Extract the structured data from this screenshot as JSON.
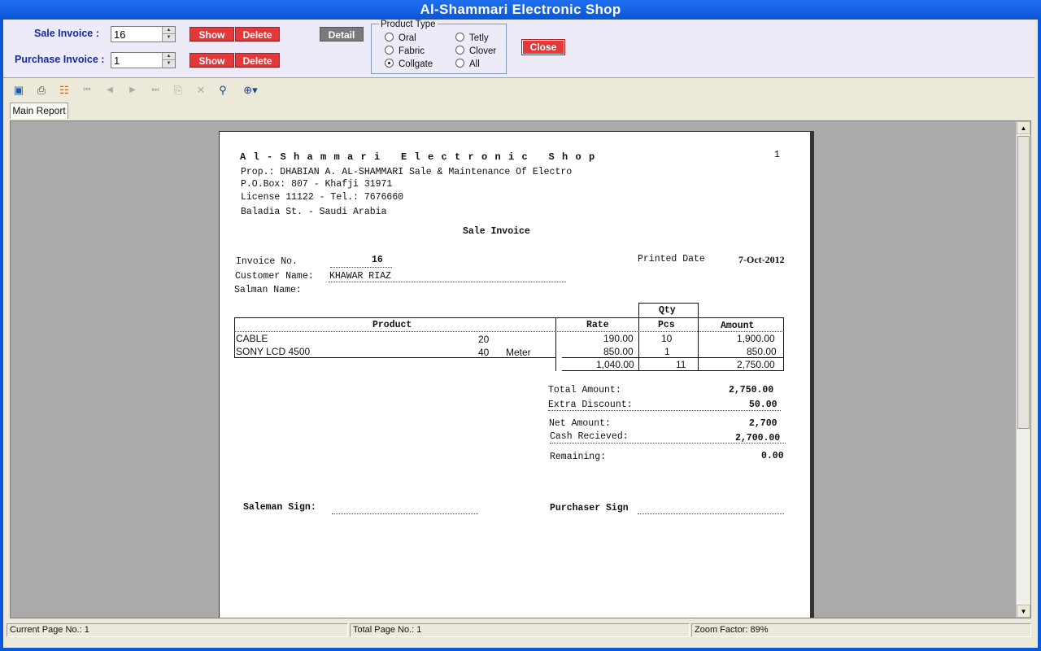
{
  "window": {
    "title": "Al-Shammari Electronic Shop"
  },
  "controls": {
    "sale_invoice_label": "Sale Invoice :",
    "sale_invoice_value": "16",
    "purchase_invoice_label": "Purchase Invoice :",
    "purchase_invoice_value": "1",
    "show_label": "Show",
    "delete_label": "Delete",
    "detail_label": "Detail",
    "close_label": "Close",
    "product_type": {
      "legend": "Product Type",
      "options": [
        "Oral",
        "Fabric",
        "Collgate",
        "Tetly",
        "Clover",
        "All"
      ],
      "selected": "Collgate"
    }
  },
  "toolbar": {
    "icons": [
      "export-icon",
      "print-icon",
      "toggle-tree-icon",
      "first-page-icon",
      "prev-page-icon",
      "next-page-icon",
      "last-page-icon",
      "goto-page-icon",
      "stop-icon",
      "search-icon",
      "zoom-icon"
    ]
  },
  "tabs": [
    "Main Report"
  ],
  "report": {
    "shop_name": "Al-Shammari Electronic Shop",
    "page_no": "1",
    "prop_line": "Prop.: DHABIAN A. AL-SHAMMARI Sale & Maintenance Of Electro",
    "pobox_line": "P.O.Box: 807 - Khafji 31971",
    "license_line": "License 11122 - Tel.: 7676660",
    "address_line": "Baladia St. - Saudi Arabia",
    "doc_title": "Sale Invoice",
    "invoice_no_label": "Invoice No.",
    "invoice_no": "16",
    "printed_date_label": "Printed Date",
    "printed_date": "7-Oct-2012",
    "customer_label": "Customer Name:",
    "customer_name": "KHAWAR RIAZ",
    "salesman_label": "Salman Name:",
    "headers": {
      "product": "Product",
      "rate": "Rate",
      "qty": "Qty",
      "pcs": "Pcs",
      "amount": "Amount"
    },
    "rows": [
      {
        "product": "CABLE",
        "code": "20",
        "unit": "",
        "rate": "190.00",
        "pcs": "10",
        "amount": "1,900.00"
      },
      {
        "product": "SONY LCD 4500",
        "code": "40",
        "unit": "Meter",
        "rate": "850.00",
        "pcs": "1",
        "amount": "850.00"
      }
    ],
    "totals_row": {
      "rate": "1,040.00",
      "pcs": "11",
      "amount": "2,750.00"
    },
    "summary": {
      "total_amount_label": "Total Amount:",
      "total_amount": "2,750.00",
      "extra_discount_label": "Extra Discount:",
      "extra_discount": "50.00",
      "net_amount_label": "Net Amount:",
      "net_amount": "2,700",
      "cash_received_label": "Cash Recieved:",
      "cash_received": "2,700.00",
      "remaining_label": "Remaining:",
      "remaining": "0.00"
    },
    "saleman_sign_label": "Saleman Sign:",
    "purchaser_sign_label": "Purchaser Sign"
  },
  "status": {
    "current_page": "Current Page No.: 1",
    "total_page": "Total Page No.: 1",
    "zoom": "Zoom Factor: 89%"
  }
}
